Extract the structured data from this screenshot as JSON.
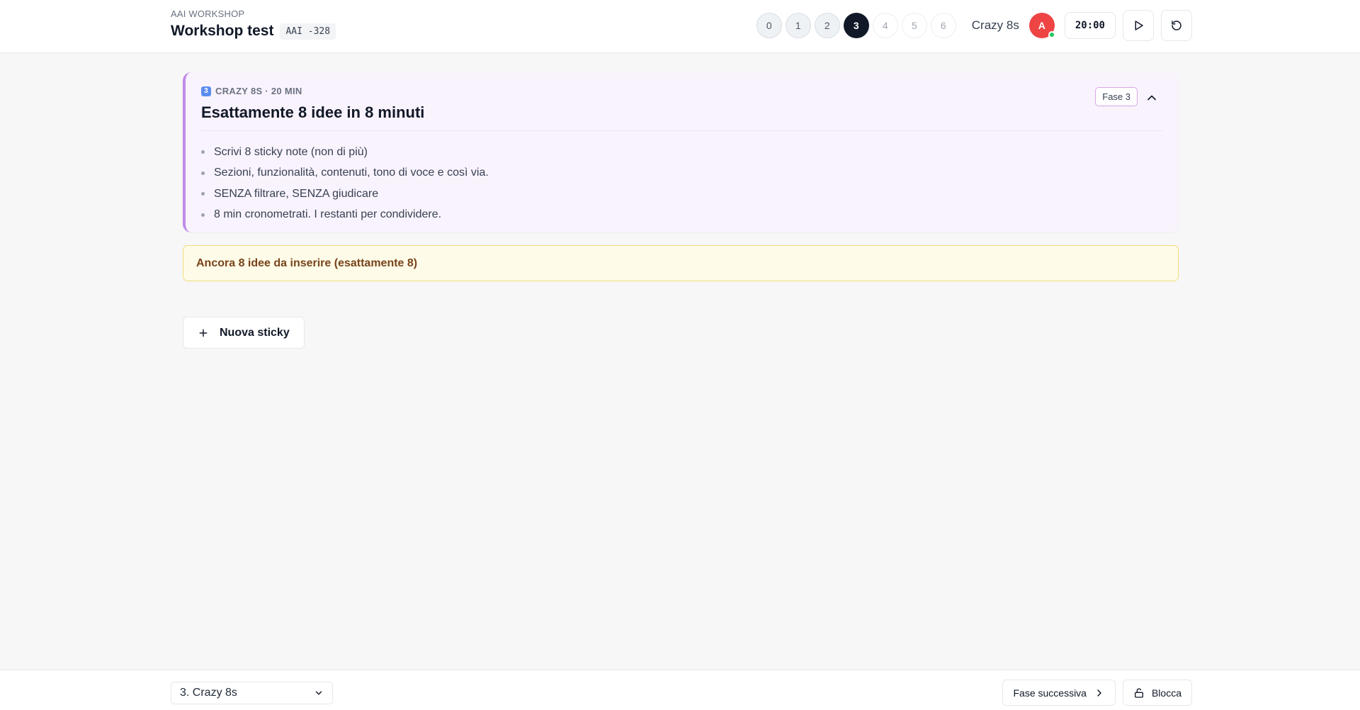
{
  "header": {
    "workshop_label": "AAI WORKSHOP",
    "title": "Workshop test",
    "code": "AAI -328",
    "phases": [
      "0",
      "1",
      "2",
      "3",
      "4",
      "5",
      "6"
    ],
    "current_phase_name": "Crazy 8s",
    "avatar_initial": "A",
    "timer": "20:00"
  },
  "card": {
    "step_icon": "3",
    "meta": "CRAZY 8S · 20 MIN",
    "title": "Esattamente 8 idee in 8 minuti",
    "badge": "Fase 3",
    "bullets": [
      "Scrivi 8 sticky note (non di più)",
      "Sezioni, funzionalità, contenuti, tono di voce e così via.",
      "SENZA filtrare, SENZA giudicare",
      "8 min cronometrati. I restanti per condividere."
    ]
  },
  "warning": {
    "text": "Ancora 8 idee da inserire (esattamente 8)"
  },
  "actions": {
    "new_sticky": "Nuova sticky"
  },
  "footer": {
    "selected_phase": "3. Crazy 8s",
    "next_label": "Fase successiva",
    "lock_label": "Blocca"
  },
  "colors": {
    "accent": "#c08be8",
    "active_phase": "#111827",
    "avatar": "#ef4444",
    "online": "#22c55e",
    "warning_bg": "#fefbe8"
  }
}
